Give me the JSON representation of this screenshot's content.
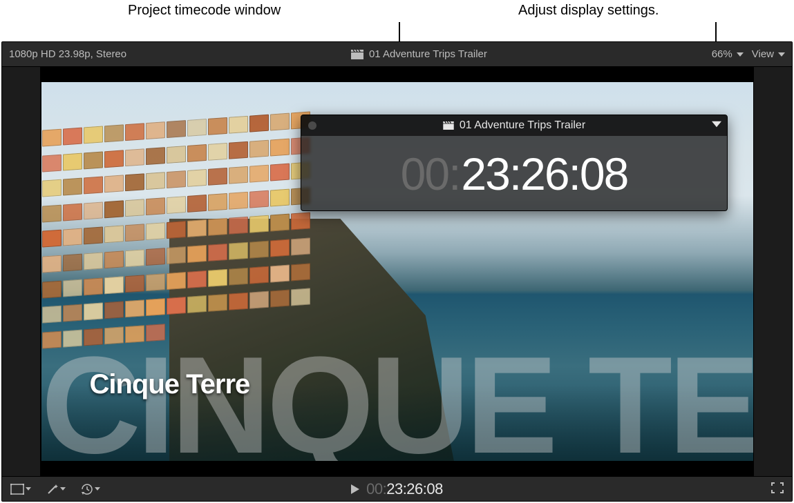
{
  "callouts": {
    "left": "Project timecode window",
    "right": "Adjust display settings."
  },
  "topbar": {
    "format": "1080p HD 23.98p, Stereo",
    "project_name": "01 Adventure Trips Trailer",
    "zoom": "66%",
    "view_label": "View"
  },
  "viewer": {
    "ghost_title": "CINQUE TERRE",
    "subtitle": "Cinque Terre"
  },
  "timecode_window": {
    "title": "01 Adventure Trips Trailer",
    "prefix": "00:",
    "value": "23:26:08"
  },
  "bottombar": {
    "play_icon": "play",
    "tc_prefix": "00:",
    "tc_value": "23:26:08"
  }
}
